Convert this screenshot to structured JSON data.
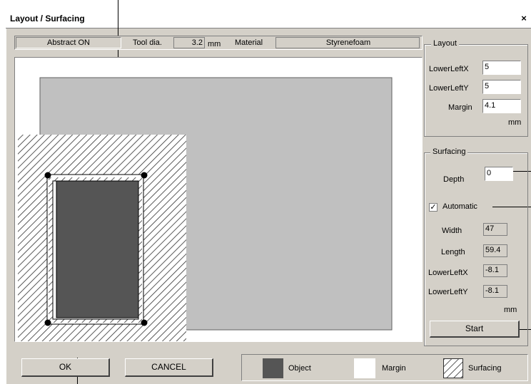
{
  "window": {
    "title": "Layout / Surfacing",
    "close_glyph": "×"
  },
  "statusbar": {
    "mode": "Abstract ON",
    "tool_label": "Tool dia.",
    "tool_value": "3.2",
    "tool_unit": "mm",
    "material_label": "Material",
    "material_value": "Styrenefoam"
  },
  "layout_group": {
    "title": "Layout",
    "lower_left_x_label": "LowerLeftX",
    "lower_left_x": "5",
    "lower_left_y_label": "LowerLeftY",
    "lower_left_y": "5",
    "margin_label": "Margin",
    "margin": "4.1",
    "unit": "mm"
  },
  "surfacing_group": {
    "title": "Surfacing",
    "depth_label": "Depth",
    "depth": "0",
    "automatic_label": "Automatic",
    "automatic_checked": true,
    "check_glyph": "✓",
    "width_label": "Width",
    "width": "47",
    "length_label": "Length",
    "length": "59.4",
    "lower_left_x_label": "LowerLeftX",
    "lower_left_x": "-8.1",
    "lower_left_y_label": "LowerLeftY",
    "lower_left_y": "-8.1",
    "unit": "mm",
    "start_label": "Start"
  },
  "buttons": {
    "ok": "OK",
    "cancel": "CANCEL"
  },
  "legend": {
    "object": "Object",
    "margin": "Margin",
    "surfacing": "Surfacing",
    "colors": {
      "object": "#555555",
      "margin": "#ffffff",
      "material": "#c0c0c0"
    }
  }
}
